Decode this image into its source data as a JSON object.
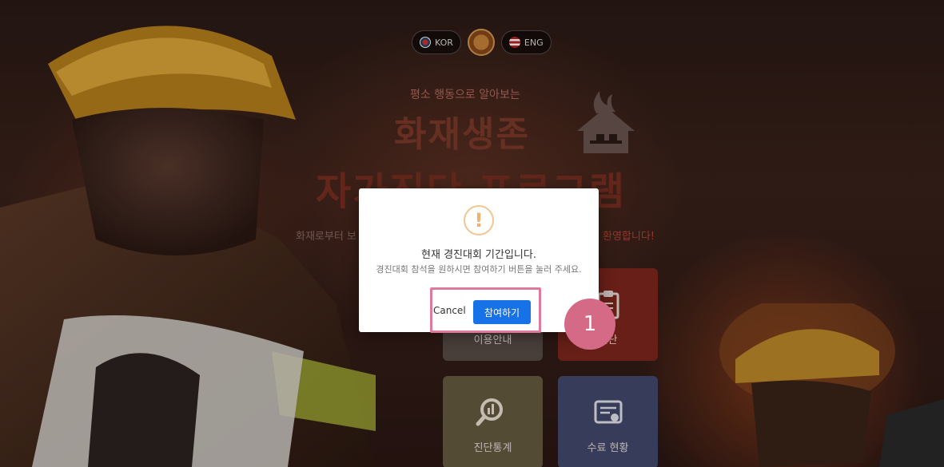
{
  "lang": {
    "kor_label": "KOR",
    "eng_label": "ENG"
  },
  "hero": {
    "subtitle": "평소 행동으로 알아보는",
    "title_line1": "화재생존",
    "title_line2": "자가진단 프로그램",
    "welcome_left": "화재로부터 보",
    "welcome_right": "환영합니다!"
  },
  "tiles": {
    "guide": "이용안내",
    "diagnosis": "진단",
    "stats": "진단통계",
    "certificate": "수료 현황"
  },
  "modal": {
    "icon": "!",
    "title": "현재 경진대회 기간입니다.",
    "text": "경진대회 참석을 원하시면 참여하기 버튼을 눌러 주세요.",
    "cancel_label": "Cancel",
    "confirm_label": "참여하기"
  },
  "annotation": {
    "step": "1"
  },
  "colors": {
    "accent": "#1672e6",
    "highlight": "#e07a9a",
    "badge": "#d46a86"
  }
}
